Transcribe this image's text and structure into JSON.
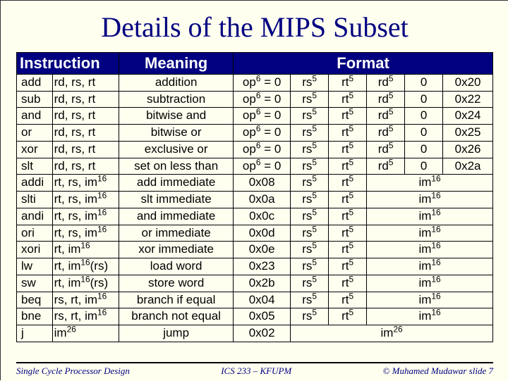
{
  "title": "Details of the MIPS Subset",
  "headers": {
    "instruction": "Instruction",
    "meaning": "Meaning",
    "format": "Format"
  },
  "footer": {
    "left": "Single Cycle Processor Design",
    "center": "ICS 233 – KFUPM",
    "right": "© Muhamed Mudawar   slide 7"
  },
  "rows": [
    {
      "mn": "add",
      "ops": "rd, rs, rt",
      "meaning": "addition",
      "f": [
        "op^6 = 0",
        "rs^5",
        "rt^5",
        "rd^5",
        "0",
        "0x20"
      ]
    },
    {
      "mn": "sub",
      "ops": "rd, rs, rt",
      "meaning": "subtraction",
      "f": [
        "op^6 = 0",
        "rs^5",
        "rt^5",
        "rd^5",
        "0",
        "0x22"
      ]
    },
    {
      "mn": "and",
      "ops": "rd, rs, rt",
      "meaning": "bitwise and",
      "f": [
        "op^6 = 0",
        "rs^5",
        "rt^5",
        "rd^5",
        "0",
        "0x24"
      ]
    },
    {
      "mn": "or",
      "ops": "rd, rs, rt",
      "meaning": "bitwise or",
      "f": [
        "op^6 = 0",
        "rs^5",
        "rt^5",
        "rd^5",
        "0",
        "0x25"
      ]
    },
    {
      "mn": "xor",
      "ops": "rd, rs, rt",
      "meaning": "exclusive or",
      "f": [
        "op^6 = 0",
        "rs^5",
        "rt^5",
        "rd^5",
        "0",
        "0x26"
      ]
    },
    {
      "mn": "slt",
      "ops": "rd, rs, rt",
      "meaning": "set on less than",
      "f": [
        "op^6 = 0",
        "rs^5",
        "rt^5",
        "rd^5",
        "0",
        "0x2a"
      ]
    },
    {
      "mn": "addi",
      "ops": "rt, rs, im^16",
      "meaning": "add immediate",
      "f": [
        "0x08",
        "rs^5",
        "rt^5",
        {
          "span": 3,
          "text": "im^16"
        }
      ]
    },
    {
      "mn": "slti",
      "ops": "rt, rs, im^16",
      "meaning": "slt immediate",
      "f": [
        "0x0a",
        "rs^5",
        "rt^5",
        {
          "span": 3,
          "text": "im^16"
        }
      ]
    },
    {
      "mn": "andi",
      "ops": "rt, rs, im^16",
      "meaning": "and immediate",
      "f": [
        "0x0c",
        "rs^5",
        "rt^5",
        {
          "span": 3,
          "text": "im^16"
        }
      ]
    },
    {
      "mn": "ori",
      "ops": "rt, rs, im^16",
      "meaning": "or immediate",
      "f": [
        "0x0d",
        "rs^5",
        "rt^5",
        {
          "span": 3,
          "text": "im^16"
        }
      ]
    },
    {
      "mn": "xori",
      "ops": "rt, im^16",
      "meaning": "xor immediate",
      "f": [
        "0x0e",
        "rs^5",
        "rt^5",
        {
          "span": 3,
          "text": "im^16"
        }
      ]
    },
    {
      "mn": "lw",
      "ops": "rt, im^16(rs)",
      "meaning": "load word",
      "f": [
        "0x23",
        "rs^5",
        "rt^5",
        {
          "span": 3,
          "text": "im^16"
        }
      ]
    },
    {
      "mn": "sw",
      "ops": "rt, im^16(rs)",
      "meaning": "store word",
      "f": [
        "0x2b",
        "rs^5",
        "rt^5",
        {
          "span": 3,
          "text": "im^16"
        }
      ]
    },
    {
      "mn": "beq",
      "ops": "rs, rt, im^16",
      "meaning": "branch if equal",
      "f": [
        "0x04",
        "rs^5",
        "rt^5",
        {
          "span": 3,
          "text": "im^16"
        }
      ]
    },
    {
      "mn": "bne",
      "ops": "rs, rt, im^16",
      "meaning": "branch not equal",
      "f": [
        "0x05",
        "rs^5",
        "rt^5",
        {
          "span": 3,
          "text": "im^16"
        }
      ]
    },
    {
      "mn": "j",
      "ops": "im^26",
      "meaning": "jump",
      "f": [
        "0x02",
        {
          "span": 5,
          "text": "im^26"
        }
      ]
    }
  ]
}
